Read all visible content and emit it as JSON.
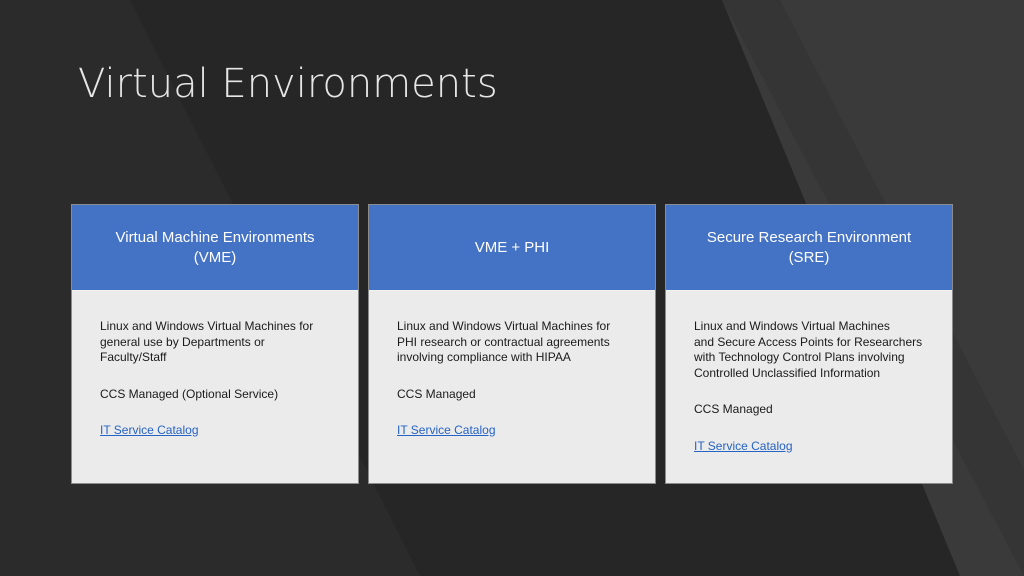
{
  "slide": {
    "title": "Virtual Environments"
  },
  "colors": {
    "background": "#262626",
    "header_blue": "#4472c4",
    "card_body": "#ebebeb",
    "link": "#2563c4"
  },
  "cards": [
    {
      "title": "Virtual Machine Environments\n(VME)",
      "description": "Linux and Windows Virtual Machines for\ngeneral use by Departments or\nFaculty/Staff",
      "managed": "CCS Managed (Optional Service)",
      "link_label": "IT Service Catalog"
    },
    {
      "title": "VME + PHI",
      "description": "Linux and Windows Virtual Machines for\nPHI research or contractual agreements\ninvolving compliance with HIPAA",
      "managed": "CCS Managed",
      "link_label": "IT Service Catalog"
    },
    {
      "title": "Secure Research Environment\n(SRE)",
      "description": "Linux and Windows Virtual Machines\nand Secure Access Points for Researchers\nwith Technology Control Plans involving\nControlled Unclassified Information",
      "managed": "CCS Managed",
      "link_label": "IT Service Catalog"
    }
  ]
}
